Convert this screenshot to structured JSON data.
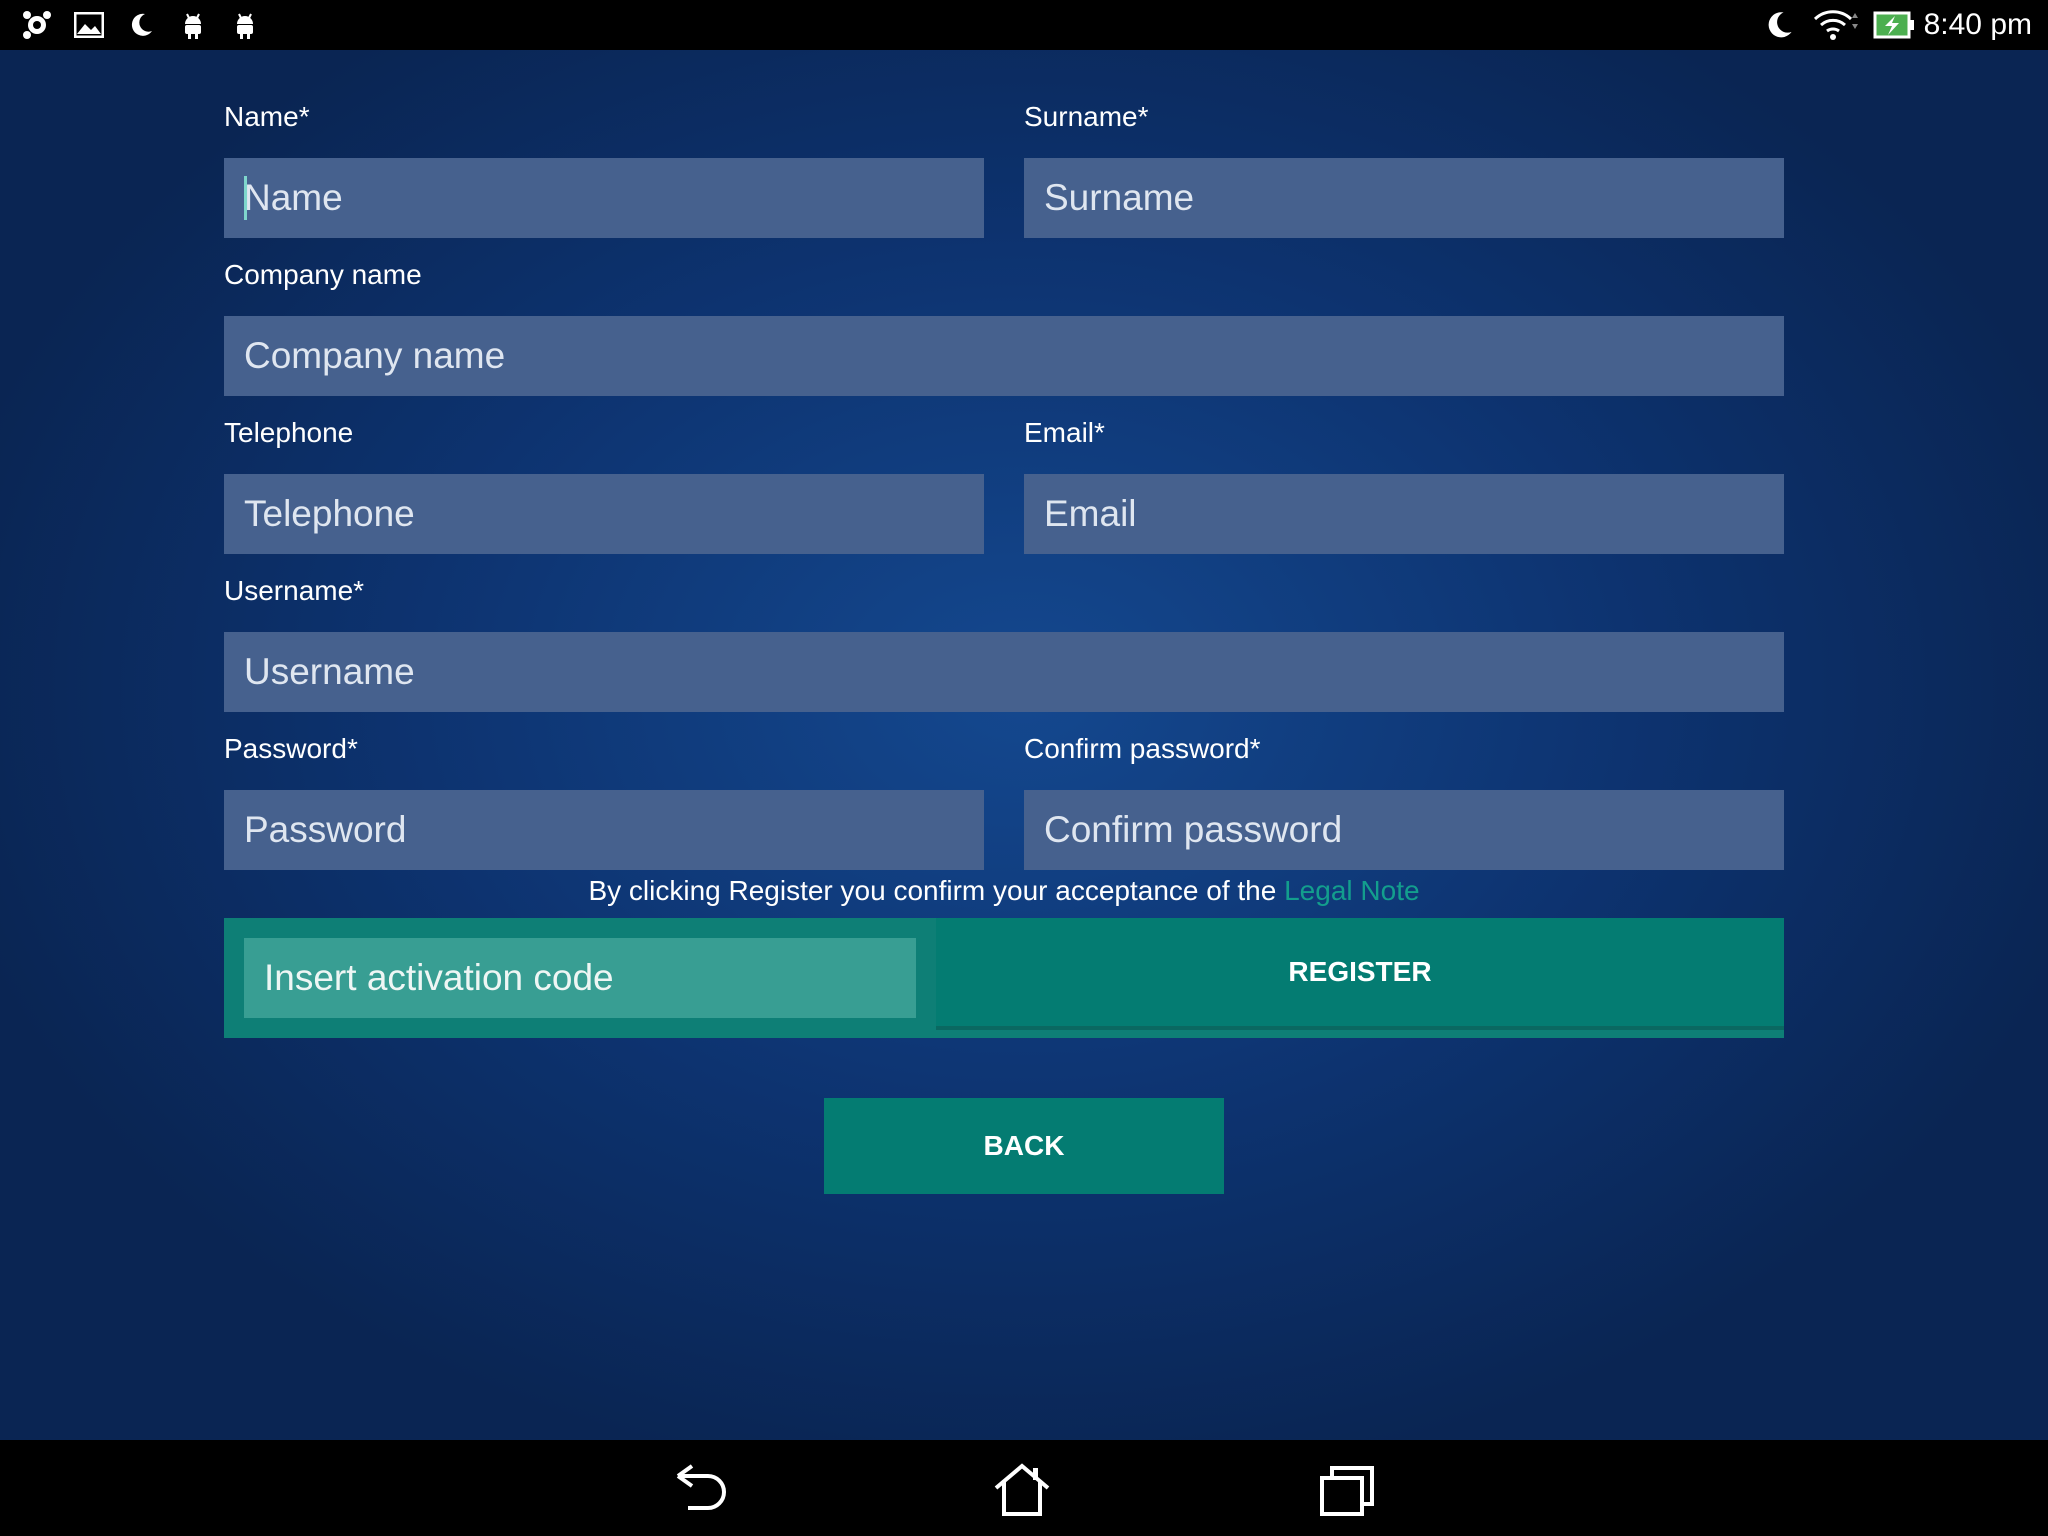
{
  "status_bar": {
    "left_icons": [
      "app-icon",
      "gallery-icon",
      "moon-icon",
      "android-icon",
      "android-icon"
    ],
    "right_icons": [
      "moon-icon",
      "wifi-icon",
      "battery-charging-icon"
    ],
    "time": "8:40 pm"
  },
  "form": {
    "name": {
      "label": "Name*",
      "placeholder": "Name"
    },
    "surname": {
      "label": "Surname*",
      "placeholder": "Surname"
    },
    "company": {
      "label": "Company name",
      "placeholder": "Company name"
    },
    "telephone": {
      "label": "Telephone",
      "placeholder": "Telephone"
    },
    "email": {
      "label": "Email*",
      "placeholder": "Email"
    },
    "username": {
      "label": "Username*",
      "placeholder": "Username"
    },
    "password": {
      "label": "Password*",
      "placeholder": "Password"
    },
    "confirm_password": {
      "label": "Confirm password*",
      "placeholder": "Confirm password"
    }
  },
  "legal": {
    "text": "By clicking Register you confirm your acceptance of the ",
    "link": "Legal Note"
  },
  "activation": {
    "placeholder": "Insert activation code"
  },
  "buttons": {
    "register": "REGISTER",
    "back": "BACK"
  },
  "colors": {
    "accent": "#047c72",
    "field_bg": "#46618e",
    "link": "#139e8d"
  }
}
